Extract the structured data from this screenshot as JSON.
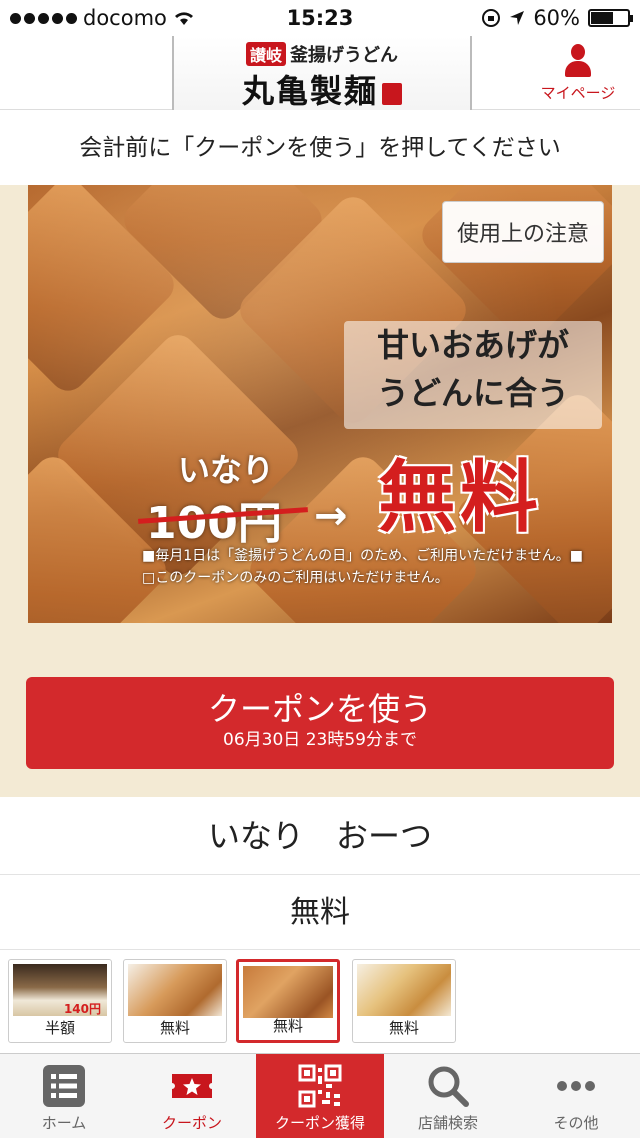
{
  "status": {
    "carrier": "docomo",
    "time": "15:23",
    "battery": "60%",
    "battery_level": 0.6
  },
  "header": {
    "logo_top": "釜揚げうどん",
    "logo_badge": "讃岐",
    "logo_main": "丸亀製麺",
    "mypage": "マイページ"
  },
  "instruction": "会計前に「クーポンを使う」を押してください",
  "coupon": {
    "notice_button": "使用上の注意",
    "catch_line1": "甘いおあげが",
    "catch_line2": "うどんに合う",
    "item_label": "いなり",
    "old_price": "100円",
    "arrow": "→",
    "free": "無料",
    "fine_1": "■毎月1日は「釜揚げうどんの日」のため、ご利用いただけません。■",
    "fine_2": "□このクーポンのみのご利用はいただけません。",
    "use_button": "クーポンを使う",
    "deadline": "06月30日 23時59分まで"
  },
  "item_name": "いなり　おーつ",
  "item_price": "無料",
  "thumbnails": [
    {
      "label": "半額",
      "price_text": "140円",
      "active": false
    },
    {
      "label": "無料",
      "active": false
    },
    {
      "label": "無料",
      "active": true
    },
    {
      "label": "無料",
      "active": false
    }
  ],
  "tabs": [
    {
      "label": "ホーム",
      "icon": "list-icon"
    },
    {
      "label": "クーポン",
      "icon": "ticket-icon"
    },
    {
      "label": "クーポン獲得",
      "icon": "qr-code-icon"
    },
    {
      "label": "店舗検索",
      "icon": "search-icon"
    },
    {
      "label": "その他",
      "icon": "more-icon"
    }
  ],
  "colors": {
    "brand_red": "#d3292c",
    "beige": "#f3ead4"
  }
}
